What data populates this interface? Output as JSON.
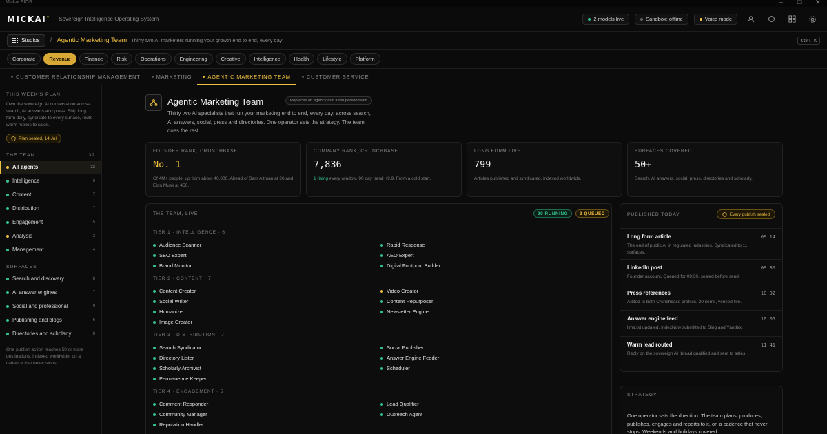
{
  "window": {
    "title": "Mickai SIOS"
  },
  "topbar": {
    "logo": "MICKAI",
    "logo_mark": "•",
    "tagline": "Sovereign Intelligence Operating System",
    "models_live": "2 models live",
    "sandbox": "Sandbox: offline",
    "voice": "Voice mode"
  },
  "crumb": {
    "studios": "Studios",
    "sep": "/",
    "title": "Agentic Marketing Team",
    "desc": "Thirty two AI marketers running your growth end to end, every day",
    "shortcut": "Ctrl K"
  },
  "categories": [
    {
      "label": "Corporate",
      "active": false
    },
    {
      "label": "Revenue",
      "active": true
    },
    {
      "label": "Finance",
      "active": false
    },
    {
      "label": "Risk",
      "active": false
    },
    {
      "label": "Operations",
      "active": false
    },
    {
      "label": "Engineering",
      "active": false
    },
    {
      "label": "Creative",
      "active": false
    },
    {
      "label": "Intelligence",
      "active": false
    },
    {
      "label": "Health",
      "active": false
    },
    {
      "label": "Lifestyle",
      "active": false
    },
    {
      "label": "Platform",
      "active": false
    }
  ],
  "tabs": [
    {
      "label": "Customer Relationship Management",
      "active": false
    },
    {
      "label": "Marketing",
      "active": false
    },
    {
      "label": "Agentic Marketing Team",
      "active": true
    },
    {
      "label": "Customer Service",
      "active": false
    }
  ],
  "sidebar": {
    "plan_heading": "This week's plan",
    "plan_text": "Own the sovereign AI conversation across search, AI answers and press. Ship long form daily, syndicate to every surface, route warm replies to sales.",
    "sealed": "Plan sealed, 14 Jul",
    "team_heading": "The team",
    "team_count": "32",
    "team": [
      {
        "label": "All agents",
        "count": "32",
        "color": "#f0c040",
        "active": true
      },
      {
        "label": "Intelligence",
        "count": "6",
        "color": "#34c38f",
        "active": false
      },
      {
        "label": "Content",
        "count": "7",
        "color": "#34c38f",
        "active": false
      },
      {
        "label": "Distribution",
        "count": "7",
        "color": "#34c38f",
        "active": false
      },
      {
        "label": "Engagement",
        "count": "5",
        "color": "#34c38f",
        "active": false
      },
      {
        "label": "Analysis",
        "count": "3",
        "color": "#f0c040",
        "active": false
      },
      {
        "label": "Management",
        "count": "4",
        "color": "#34c38f",
        "active": false
      }
    ],
    "surfaces_heading": "Surfaces",
    "surfaces": [
      {
        "label": "Search and discovery",
        "count": "8"
      },
      {
        "label": "AI answer engines",
        "count": "7"
      },
      {
        "label": "Social and professional",
        "count": "9"
      },
      {
        "label": "Publishing and blogs",
        "count": "6"
      },
      {
        "label": "Directories and scholarly",
        "count": "8"
      }
    ],
    "footer": "One publish action reaches 50 or more destinations, indexed worldwide, on a cadence that never stops."
  },
  "hero": {
    "title": "Agentic Marketing Team",
    "badge": "Replaces an agency and a ten person team",
    "desc": "Thirty two AI specialists that run your marketing end to end, every day, across search, AI answers, social, press and directories. One operator sets the strategy. The team does the rest."
  },
  "stats": [
    {
      "heading": "Founder rank, Crunchbase",
      "value": "No. 1",
      "gold": true,
      "sub_green": "",
      "sub": "Of 4M+ people, up from about 40,000. Ahead of Sam Altman at 26 and Elon Musk at 450."
    },
    {
      "heading": "Company rank, Crunchbase",
      "value": "7,836",
      "gold": false,
      "sub_green": "1 rising",
      "sub": " every window. 90 day trend +9.9. From a cold start."
    },
    {
      "heading": "Long form live",
      "value": "799",
      "gold": false,
      "sub_green": "",
      "sub": "Articles published and syndicated, indexed worldwide."
    },
    {
      "heading": "Surfaces covered",
      "value": "50+",
      "gold": false,
      "sub_green": "",
      "sub": "Search, AI answers, social, press, directories and scholarly."
    }
  ],
  "team": {
    "heading": "The team, live",
    "running": "29 RUNNING",
    "queued": "3 QUEUED",
    "tiers": [
      {
        "heading": "Tier 1 · Intelligence · 6",
        "left": [
          {
            "name": "Audience Scanner",
            "status": "g"
          },
          {
            "name": "SEO Expert",
            "status": "g"
          },
          {
            "name": "Brand Monitor",
            "status": "g"
          }
        ],
        "right": [
          {
            "name": "Rapid Response",
            "status": "g"
          },
          {
            "name": "AEO Expert",
            "status": "g"
          },
          {
            "name": "Digital Footprint Builder",
            "status": "g"
          }
        ]
      },
      {
        "heading": "Tier 2 · Content · 7",
        "left": [
          {
            "name": "Content Creator",
            "status": "g"
          },
          {
            "name": "Social Writer",
            "status": "g"
          },
          {
            "name": "Humanizer",
            "status": "g"
          },
          {
            "name": "Image Creator",
            "status": "g"
          }
        ],
        "right": [
          {
            "name": "Video Creator",
            "status": "y"
          },
          {
            "name": "Content Repurposer",
            "status": "g"
          },
          {
            "name": "Newsletter Engine",
            "status": "g"
          }
        ]
      },
      {
        "heading": "Tier 3 · Distribution · 7",
        "left": [
          {
            "name": "Search Syndicator",
            "status": "g"
          },
          {
            "name": "Directory Lister",
            "status": "g"
          },
          {
            "name": "Scholarly Archivist",
            "status": "g"
          },
          {
            "name": "Permanence Keeper",
            "status": "g"
          }
        ],
        "right": [
          {
            "name": "Social Publisher",
            "status": "g"
          },
          {
            "name": "Answer Engine Feeder",
            "status": "g"
          },
          {
            "name": "Scheduler",
            "status": "g"
          }
        ]
      },
      {
        "heading": "Tier 4 · Engagement · 5",
        "left": [
          {
            "name": "Comment Responder",
            "status": "g"
          },
          {
            "name": "Community Manager",
            "status": "g"
          },
          {
            "name": "Reputation Handler",
            "status": "g"
          }
        ],
        "right": [
          {
            "name": "Lead Qualifier",
            "status": "g"
          },
          {
            "name": "Outreach Agent",
            "status": "g"
          }
        ]
      }
    ]
  },
  "published": {
    "heading": "Published today",
    "seal": "Every publish sealed",
    "items": [
      {
        "title": "Long form article",
        "time": "09:14",
        "desc": "The end of public AI in regulated industries. Syndicated to 11 surfaces."
      },
      {
        "title": "LinkedIn post",
        "time": "09:30",
        "desc": "Founder account. Queued for 09:30, sealed before send."
      },
      {
        "title": "Press references",
        "time": "10:02",
        "desc": "Added to both Crunchbase profiles, 20 items, verified live."
      },
      {
        "title": "Answer engine feed",
        "time": "10:05",
        "desc": "llms.txt updated, IndexNow submitted to Bing and Yandex."
      },
      {
        "title": "Warm lead routed",
        "time": "11:41",
        "desc": "Reply on the sovereign AI thread qualified and sent to sales."
      }
    ]
  },
  "strategy": {
    "heading": "Strategy",
    "text": "One operator sets the direction. The team plans, produces, publishes, engages and reports to it, on a cadence that never stops. Weekends and holidays covered."
  }
}
